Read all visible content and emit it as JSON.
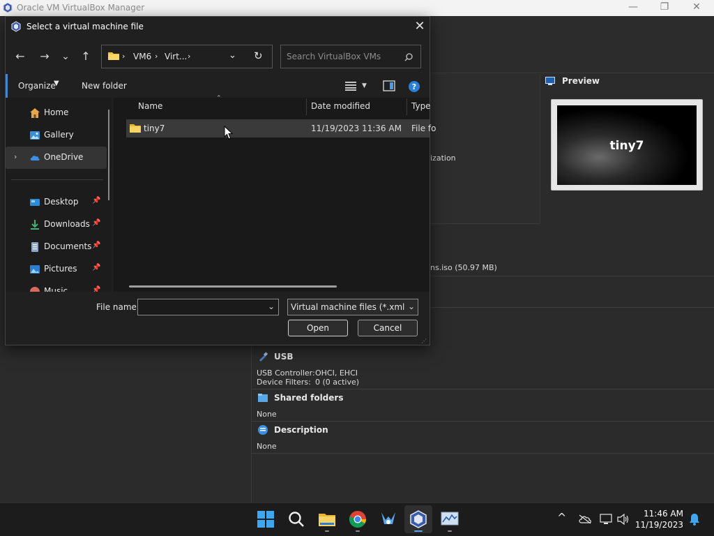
{
  "background_window": {
    "title": "Oracle VM VirtualBox Manager",
    "minimize_glyph": "—",
    "maximize_glyph": "❐",
    "close_glyph": "✕",
    "preview": {
      "header": "Preview",
      "vm_name": "tiny7"
    },
    "partial_texts": {
      "acceleration": "ization",
      "storage_iso": "ns.iso (50.97 MB)"
    },
    "usb": {
      "header": "USB",
      "controller_label": "USB Controller:",
      "controller_value": "OHCI, EHCI",
      "filters_label": "Device Filters:",
      "filters_value": "0 (0 active)"
    },
    "shared_folders": {
      "header": "Shared folders",
      "value": "None"
    },
    "description": {
      "header": "Description",
      "value": "None"
    }
  },
  "dialog": {
    "title": "Select a virtual machine file",
    "close_glyph": "✕",
    "nav": {
      "back": "←",
      "forward": "→",
      "recent": "⌄",
      "up": "↑",
      "refresh": "↻"
    },
    "breadcrumb": [
      "VM6",
      "Virt...",
      "›"
    ],
    "breadcrumb_sep": "›",
    "search_placeholder": "Search VirtualBox VMs",
    "command_bar": {
      "organize": "Organize",
      "new_folder": "New folder"
    },
    "nav_pane": {
      "home": "Home",
      "gallery": "Gallery",
      "onedrive": "OneDrive",
      "desktop": "Desktop",
      "downloads": "Downloads",
      "documents": "Documents",
      "pictures": "Pictures",
      "music": "Music"
    },
    "columns": {
      "name": "Name",
      "date_modified": "Date modified",
      "type": "Type"
    },
    "files": [
      {
        "name": "tiny7",
        "date_modified": "11/19/2023 11:36 AM",
        "type": "File fo"
      }
    ],
    "file_name_label": "File name:",
    "file_name_value": "",
    "file_type_value": "Virtual machine files (*.xml *.vb",
    "open_button": "Open",
    "cancel_button": "Cancel"
  },
  "taskbar": {
    "time": "11:46 AM",
    "date": "11/19/2023",
    "tray_chevron": "^"
  }
}
